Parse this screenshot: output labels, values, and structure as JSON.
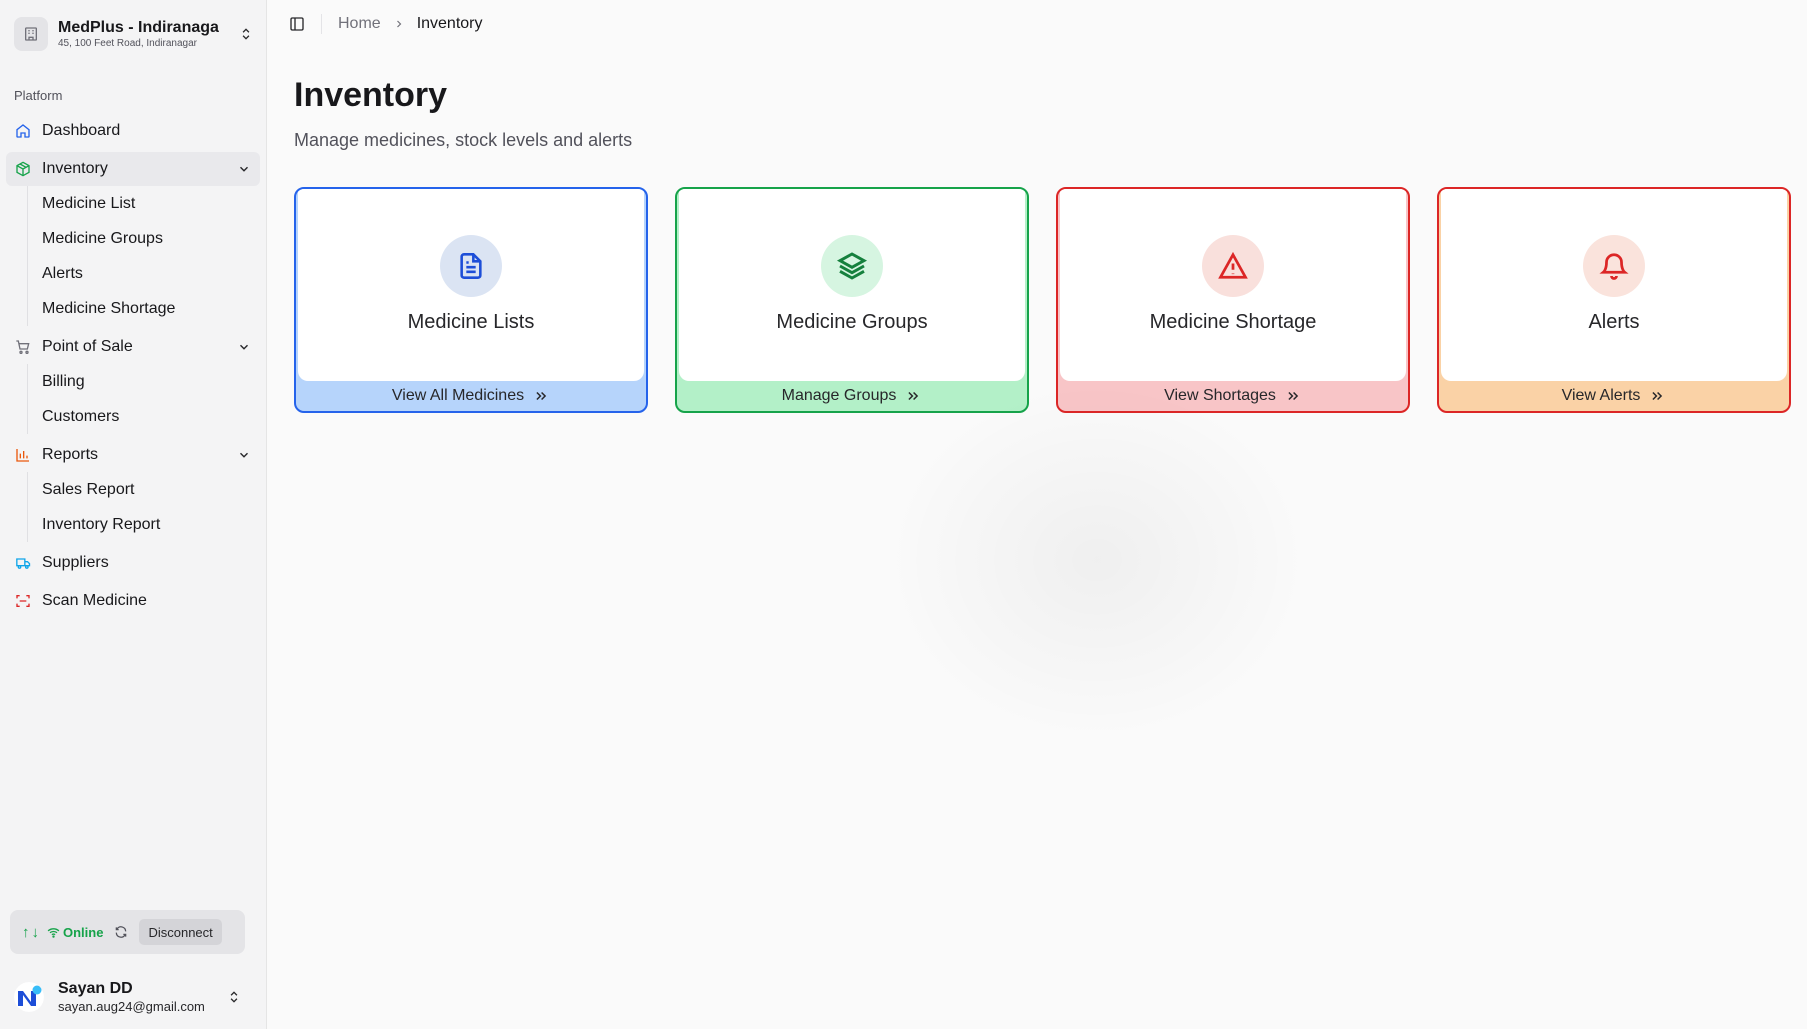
{
  "store": {
    "name": "MedPlus - Indiranaga",
    "address": "45, 100 Feet Road, Indiranagar"
  },
  "sidebar": {
    "group_label": "Platform",
    "items": [
      {
        "label": "Dashboard",
        "icon": "home-icon"
      },
      {
        "label": "Inventory",
        "icon": "package-icon",
        "children": [
          "Medicine List",
          "Medicine Groups",
          "Alerts",
          "Medicine Shortage"
        ]
      },
      {
        "label": "Point of Sale",
        "icon": "cart-icon",
        "children": [
          "Billing",
          "Customers"
        ]
      },
      {
        "label": "Reports",
        "icon": "bar-chart-icon",
        "children": [
          "Sales Report",
          "Inventory Report"
        ]
      },
      {
        "label": "Suppliers",
        "icon": "truck-icon"
      },
      {
        "label": "Scan Medicine",
        "icon": "scan-icon"
      }
    ]
  },
  "status": {
    "arrows": "↑↓",
    "online_label": "Online",
    "disconnect_label": "Disconnect"
  },
  "user": {
    "name": "Sayan DD",
    "email": "sayan.aug24@gmail.com"
  },
  "breadcrumb": {
    "home": "Home",
    "current": "Inventory"
  },
  "page": {
    "title": "Inventory",
    "subtitle": "Manage medicines, stock levels and alerts"
  },
  "cards": [
    {
      "title": "Medicine Lists",
      "action": "View All Medicines",
      "icon": "file-text-icon",
      "border": "#2563eb",
      "footer_bg": "#b6d4fb",
      "icon_bg": "#dbe4f3",
      "icon_color": "#1d4ed8"
    },
    {
      "title": "Medicine Groups",
      "action": "Manage Groups",
      "icon": "layers-icon",
      "border": "#16a34a",
      "footer_bg": "#b3f0c8",
      "icon_bg": "#d6f5e1",
      "icon_color": "#15803d"
    },
    {
      "title": "Medicine Shortage",
      "action": "View Shortages",
      "icon": "alert-triangle-icon",
      "border": "#dc2626",
      "footer_bg": "#f8c5c7",
      "icon_bg": "#f9e0dc",
      "icon_color": "#dc2626"
    },
    {
      "title": "Alerts",
      "action": "View Alerts",
      "icon": "bell-icon",
      "border": "#dc2626",
      "footer_bg": "#fad2a6",
      "icon_bg": "#fae3dc",
      "icon_color": "#dc2626"
    }
  ],
  "colors": {
    "online": "#16a34a",
    "sidebar_active": "#e9e9ec"
  }
}
